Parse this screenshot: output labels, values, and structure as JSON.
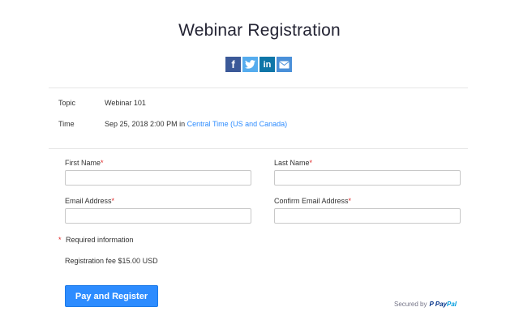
{
  "page": {
    "title": "Webinar Registration"
  },
  "social": [
    {
      "name": "facebook",
      "glyph": "f"
    },
    {
      "name": "twitter",
      "glyph": "t"
    },
    {
      "name": "linkedin",
      "glyph": "in"
    },
    {
      "name": "email",
      "glyph": "✉"
    }
  ],
  "info": {
    "topic_label": "Topic",
    "topic_value": "Webinar 101",
    "time_label": "Time",
    "time_value": "Sep 25, 2018 2:00 PM",
    "time_in": "in",
    "timezone": "Central Time (US and Canada)"
  },
  "form": {
    "first_name_label": "First Name",
    "last_name_label": "Last Name",
    "email_label": "Email Address",
    "confirm_email_label": "Confirm Email Address",
    "required_marker": "*",
    "first_name_value": "",
    "last_name_value": "",
    "email_value": "",
    "confirm_email_value": ""
  },
  "footer": {
    "required_star": "*",
    "required_info": "Required information",
    "fee": "Registration fee $15.00 USD",
    "pay_button": "Pay and Register",
    "secured_by": "Secured by",
    "paypal_a": "Pay",
    "paypal_b": "Pal"
  },
  "colors": {
    "accent": "#2d8cff",
    "required": "#e02828",
    "facebook": "#3b5998",
    "twitter": "#55acee",
    "linkedin": "#0e76a8",
    "email": "#4a90d9"
  }
}
